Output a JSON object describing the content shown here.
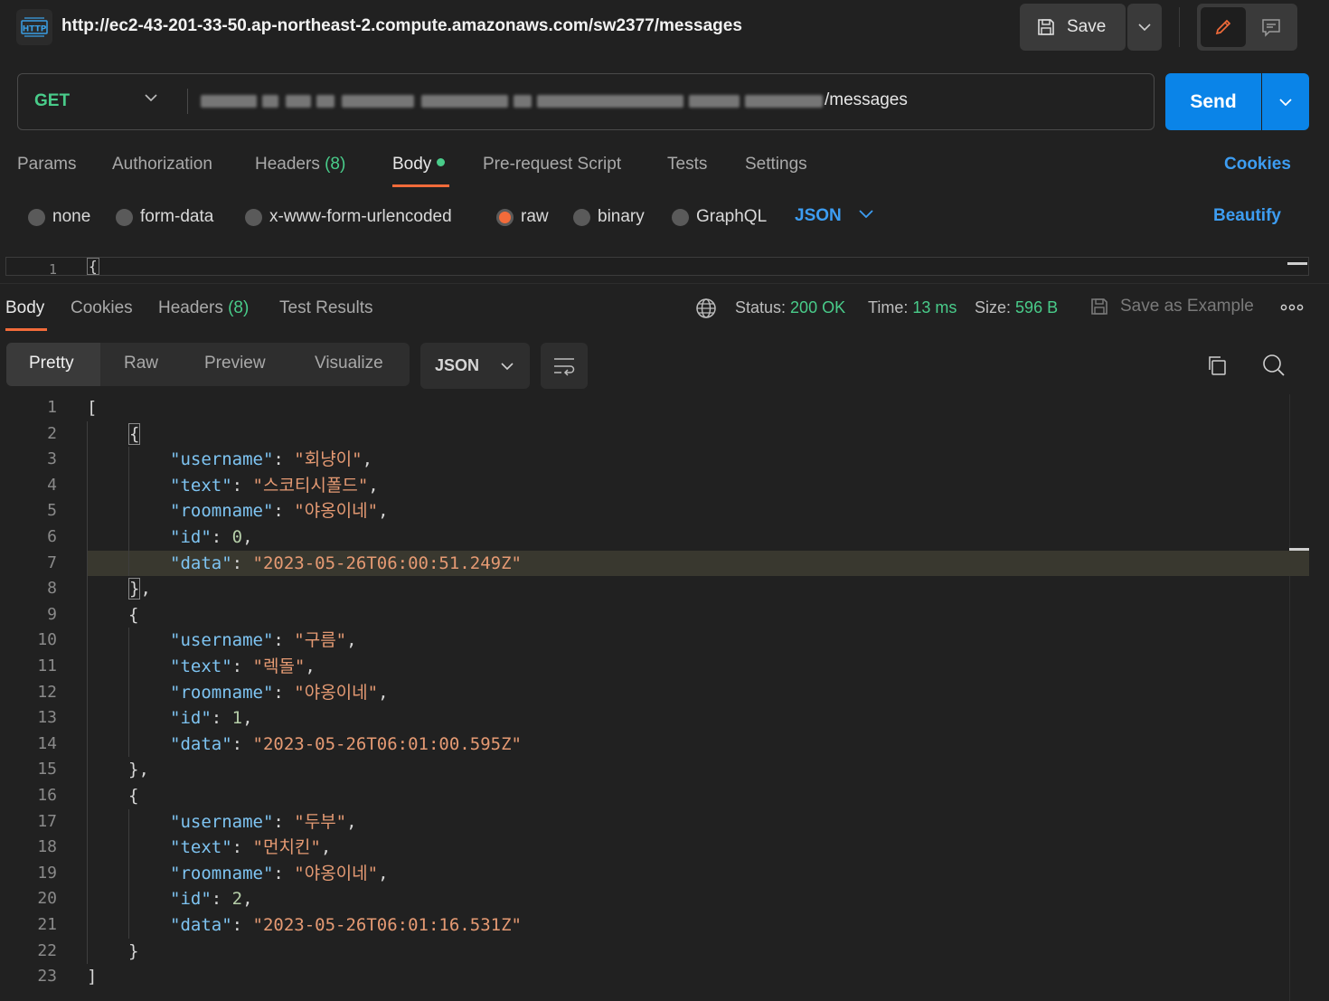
{
  "request": {
    "title": "http://ec2-43-201-33-50.ap-northeast-2.compute.amazonaws.com/sw2377/messages",
    "method": "GET",
    "url_suffix": "/messages",
    "save_label": "Save",
    "send_label": "Send"
  },
  "request_tabs": {
    "params": "Params",
    "authorization": "Authorization",
    "headers": "Headers",
    "headers_count": "(8)",
    "body": "Body",
    "pre_request": "Pre-request Script",
    "tests": "Tests",
    "settings": "Settings",
    "cookies": "Cookies"
  },
  "body_types": {
    "none": "none",
    "form_data": "form-data",
    "urlencoded": "x-www-form-urlencoded",
    "raw": "raw",
    "binary": "binary",
    "graphql": "GraphQL",
    "selected": "raw",
    "language": "JSON",
    "beautify": "Beautify"
  },
  "request_editor": {
    "line_number": "1",
    "content": "{"
  },
  "response_tabs": {
    "body": "Body",
    "cookies": "Cookies",
    "headers": "Headers",
    "headers_count": "(8)",
    "test_results": "Test Results"
  },
  "response_meta": {
    "status_label": "Status:",
    "status_value": "200 OK",
    "time_label": "Time:",
    "time_value": "13 ms",
    "size_label": "Size:",
    "size_value": "596 B",
    "save_example": "Save as Example"
  },
  "view_modes": {
    "pretty": "Pretty",
    "raw": "Raw",
    "preview": "Preview",
    "visualize": "Visualize",
    "format": "JSON"
  },
  "response_body": {
    "messages": [
      {
        "username": "회냥이",
        "text": "스코티시폴드",
        "roomname": "야옹이네",
        "id": "0",
        "data": "2023-05-26T06:00:51.249Z"
      },
      {
        "username": "구름",
        "text": "렉돌",
        "roomname": "야옹이네",
        "id": "1",
        "data": "2023-05-26T06:01:00.595Z"
      },
      {
        "username": "두부",
        "text": "먼치킨",
        "roomname": "야옹이네",
        "id": "2",
        "data": "2023-05-26T06:01:16.531Z"
      }
    ]
  },
  "colors": {
    "accent_blue": "#0a84e8",
    "active_orange": "#f26b3a",
    "success_green": "#49cc8a",
    "json_key": "#7ec4f2",
    "json_string": "#e59a73"
  }
}
